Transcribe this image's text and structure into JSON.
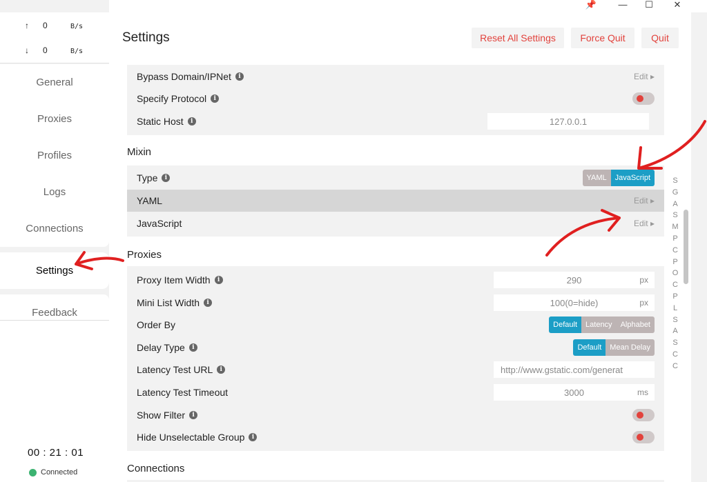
{
  "window": {
    "controls": [
      "pin-icon",
      "minimize-icon",
      "maximize-icon",
      "close-icon"
    ],
    "pin_glyph": "📌",
    "min_glyph": "—",
    "max_glyph": "☐",
    "close_glyph": "✕"
  },
  "traffic": {
    "up_arrow": "↑",
    "up_value": "0",
    "up_unit": "B/s",
    "down_arrow": "↓",
    "down_value": "0",
    "down_unit": "B/s"
  },
  "sidebar": {
    "items": [
      {
        "label": "General"
      },
      {
        "label": "Proxies"
      },
      {
        "label": "Profiles"
      },
      {
        "label": "Logs"
      },
      {
        "label": "Connections"
      },
      {
        "label": "Settings"
      },
      {
        "label": "Feedback"
      }
    ],
    "active": "Settings",
    "clock": "00 : 21 : 01",
    "status": "Connected"
  },
  "header": {
    "title": "Settings",
    "reset_label": "Reset All Settings",
    "force_quit_label": "Force Quit",
    "quit_label": "Quit"
  },
  "system_proxy": {
    "bypass_label": "Bypass Domain/IPNet",
    "bypass_action": "Edit ▸",
    "protocol_label": "Specify Protocol",
    "static_host_label": "Static Host",
    "static_host_value": "127.0.0.1"
  },
  "mixin": {
    "title": "Mixin",
    "type_label": "Type",
    "type_options": [
      "YAML",
      "JavaScript"
    ],
    "type_selected": "JavaScript",
    "yaml_label": "YAML",
    "yaml_action": "Edit ▸",
    "js_label": "JavaScript",
    "js_action": "Edit ▸"
  },
  "proxies": {
    "title": "Proxies",
    "item_width_label": "Proxy Item Width",
    "item_width_value": "290",
    "item_width_unit": "px",
    "mini_width_label": "Mini List Width",
    "mini_width_value": "100(0=hide)",
    "mini_width_unit": "px",
    "order_by_label": "Order By",
    "order_by_options": [
      "Default",
      "Latency",
      "Alphabet"
    ],
    "order_by_selected": "Default",
    "delay_type_label": "Delay Type",
    "delay_type_options": [
      "Default",
      "Mean Delay"
    ],
    "delay_type_selected": "Default",
    "latency_url_label": "Latency Test URL",
    "latency_url_value": "http://www.gstatic.com/generat",
    "latency_timeout_label": "Latency Test Timeout",
    "latency_timeout_value": "3000",
    "latency_timeout_unit": "ms",
    "show_filter_label": "Show Filter",
    "hide_unselectable_label": "Hide Unselectable Group"
  },
  "connections": {
    "title": "Connections"
  },
  "alpha_index": [
    "S",
    "G",
    "A",
    "S",
    "M",
    "P",
    "C",
    "P",
    "O",
    "C",
    "P",
    "L",
    "S",
    "A",
    "S",
    "C",
    "C"
  ],
  "colors": {
    "accent": "#1c9ec6",
    "danger": "#e2423c",
    "annotation": "#e02020"
  }
}
